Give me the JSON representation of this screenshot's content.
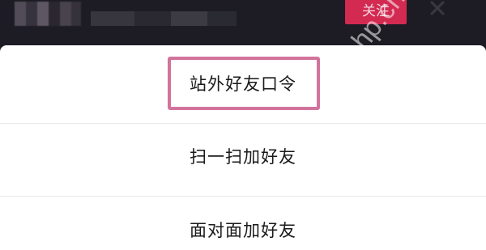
{
  "header": {
    "follow_label": "关注",
    "close_icon": "close-icon",
    "watermark_text": "php.cn"
  },
  "menu": {
    "items": [
      {
        "label": "站外好友口令"
      },
      {
        "label": "扫一扫加好友"
      },
      {
        "label": "面对面加好友"
      }
    ]
  },
  "colors": {
    "follow_button": "#d32a52",
    "highlight_border": "#d2739c",
    "sheet_background": "#ffffff",
    "backdrop": "#1d1c24"
  }
}
